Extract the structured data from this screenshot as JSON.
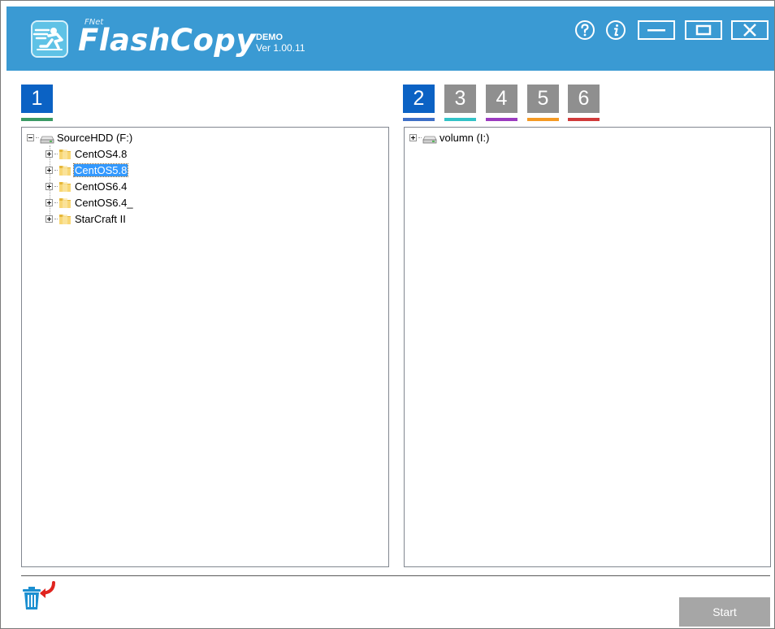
{
  "app": {
    "brand_small": "FNet",
    "brand": "FlashCopy",
    "edition": "DEMO",
    "version": "Ver 1.00.11"
  },
  "header_buttons": [
    {
      "name": "help",
      "icon": "question-circle-icon"
    },
    {
      "name": "info",
      "icon": "info-circle-icon"
    },
    {
      "name": "minimize",
      "icon": "minimize-icon"
    },
    {
      "name": "maximize",
      "icon": "maximize-icon"
    },
    {
      "name": "close",
      "icon": "close-icon"
    }
  ],
  "source_tabs": [
    {
      "label": "1",
      "color": "#0b62c4",
      "line_color": "#3a9a64"
    }
  ],
  "target_tabs": [
    {
      "label": "2",
      "color": "#0b62c4",
      "line_color": "#3e6fc8"
    },
    {
      "label": "3",
      "color": "#8f8f8f",
      "line_color": "#32c3c8"
    },
    {
      "label": "4",
      "color": "#8f8f8f",
      "line_color": "#9b3bc0"
    },
    {
      "label": "5",
      "color": "#8f8f8f",
      "line_color": "#f59a23"
    },
    {
      "label": "6",
      "color": "#8f8f8f",
      "line_color": "#d03a3a"
    }
  ],
  "source_tree": {
    "root": "SourceHDD (F:)",
    "children": [
      "CentOS4.8",
      "CentOS5.8",
      "CentOS6.4",
      "CentOS6.4_",
      "StarCraft II"
    ],
    "selected": "CentOS5.8"
  },
  "target_tree": {
    "root": "volumn (I:)"
  },
  "footer": {
    "trash_icon": "trash-restore-icon",
    "start_label": "Start"
  },
  "colors": {
    "header_bg": "#3a9ad3",
    "selection": "#3399ff",
    "start_button": "#a6a6a6"
  }
}
